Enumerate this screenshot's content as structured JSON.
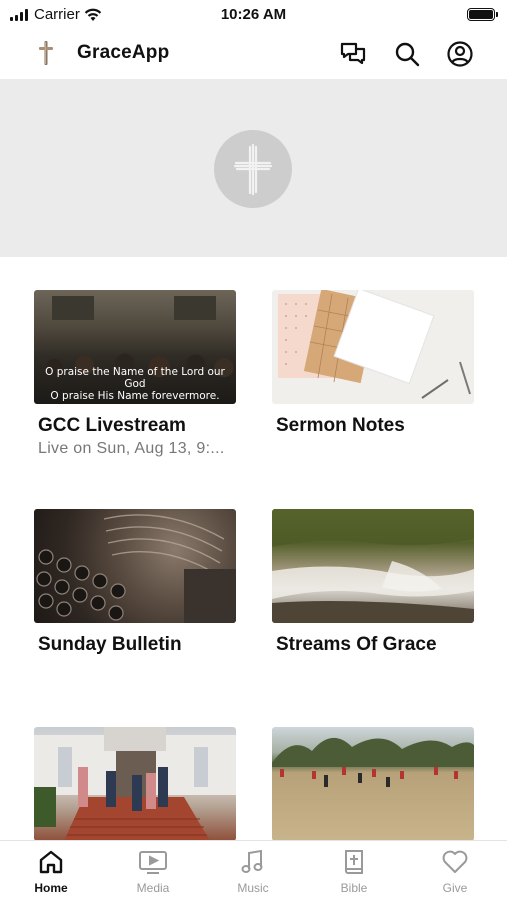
{
  "status_bar": {
    "carrier": "Carrier",
    "time": "10:26 AM"
  },
  "header": {
    "app_title": "GraceApp",
    "icons": [
      "chat-icon",
      "search-icon",
      "account-icon"
    ]
  },
  "cards": [
    {
      "title": "GCC Livestream",
      "subtitle": "Live on Sun, Aug 13, 9:...",
      "caption_line1": "O praise the Name of the Lord our God",
      "caption_line2": "O praise His Name forevermore."
    },
    {
      "title": "Sermon Notes"
    },
    {
      "title": "Sunday Bulletin"
    },
    {
      "title": "Streams Of Grace"
    },
    {
      "title": ""
    },
    {
      "title": ""
    }
  ],
  "tabs": [
    {
      "label": "Home",
      "icon": "home-icon",
      "active": true
    },
    {
      "label": "Media",
      "icon": "media-icon"
    },
    {
      "label": "Music",
      "icon": "music-icon"
    },
    {
      "label": "Bible",
      "icon": "bible-icon"
    },
    {
      "label": "Give",
      "icon": "heart-icon"
    }
  ],
  "colors": {
    "hero_bg": "#ebebeb",
    "active_tab": "#111111",
    "inactive_tab": "#9a9a9a"
  }
}
